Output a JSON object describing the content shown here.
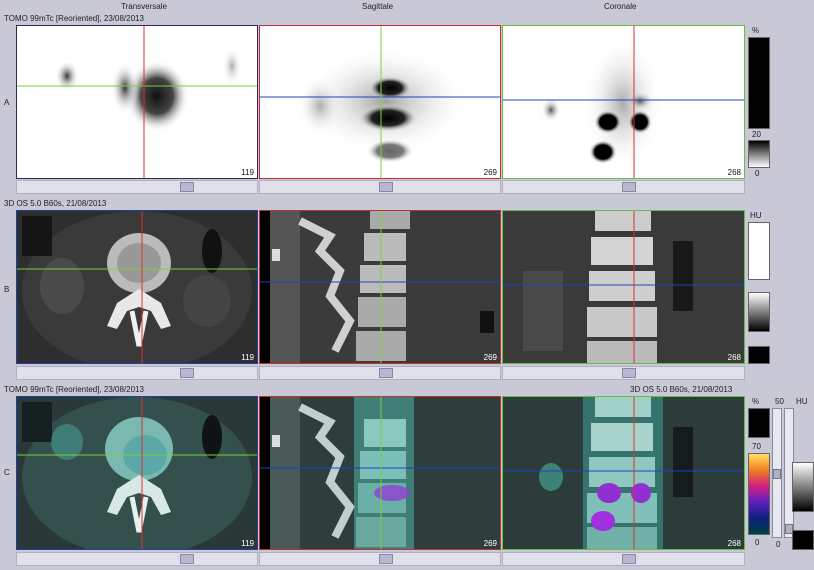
{
  "view_titles": {
    "transversale": "Transversale",
    "sagittale": "Sagittale",
    "coronale": "Coronale"
  },
  "rows": {
    "a": {
      "label": "A",
      "header": "TOMO 99mTc [Reoriented], 23/08/2013",
      "slices": [
        "119",
        "269",
        "268"
      ]
    },
    "b": {
      "label": "B",
      "header": "3D OS 5.0 B60s, 21/08/2013",
      "slices": [
        "119",
        "269",
        "268"
      ]
    },
    "c": {
      "label": "C",
      "header_left": "TOMO 99mTc [Reoriented], 23/08/2013",
      "header_right": "3D OS 5.0 B60s, 21/08/2013",
      "slices": [
        "119",
        "269",
        "268"
      ]
    }
  },
  "scales": {
    "a": {
      "unit": "%",
      "value": "20",
      "min": "0"
    },
    "b": {
      "unit": "HU"
    },
    "c": {
      "unit_pct": "%",
      "unit_hu": "HU",
      "top": "50",
      "value": "70",
      "min": "0",
      "bottom": "0"
    }
  },
  "colors": {
    "crosshair_red": "#e03030",
    "crosshair_green": "#7ad040",
    "crosshair_blue": "#2040c0",
    "frame_red": "#c03030",
    "frame_green": "#60c040",
    "frame_blue": "#2040a0"
  }
}
